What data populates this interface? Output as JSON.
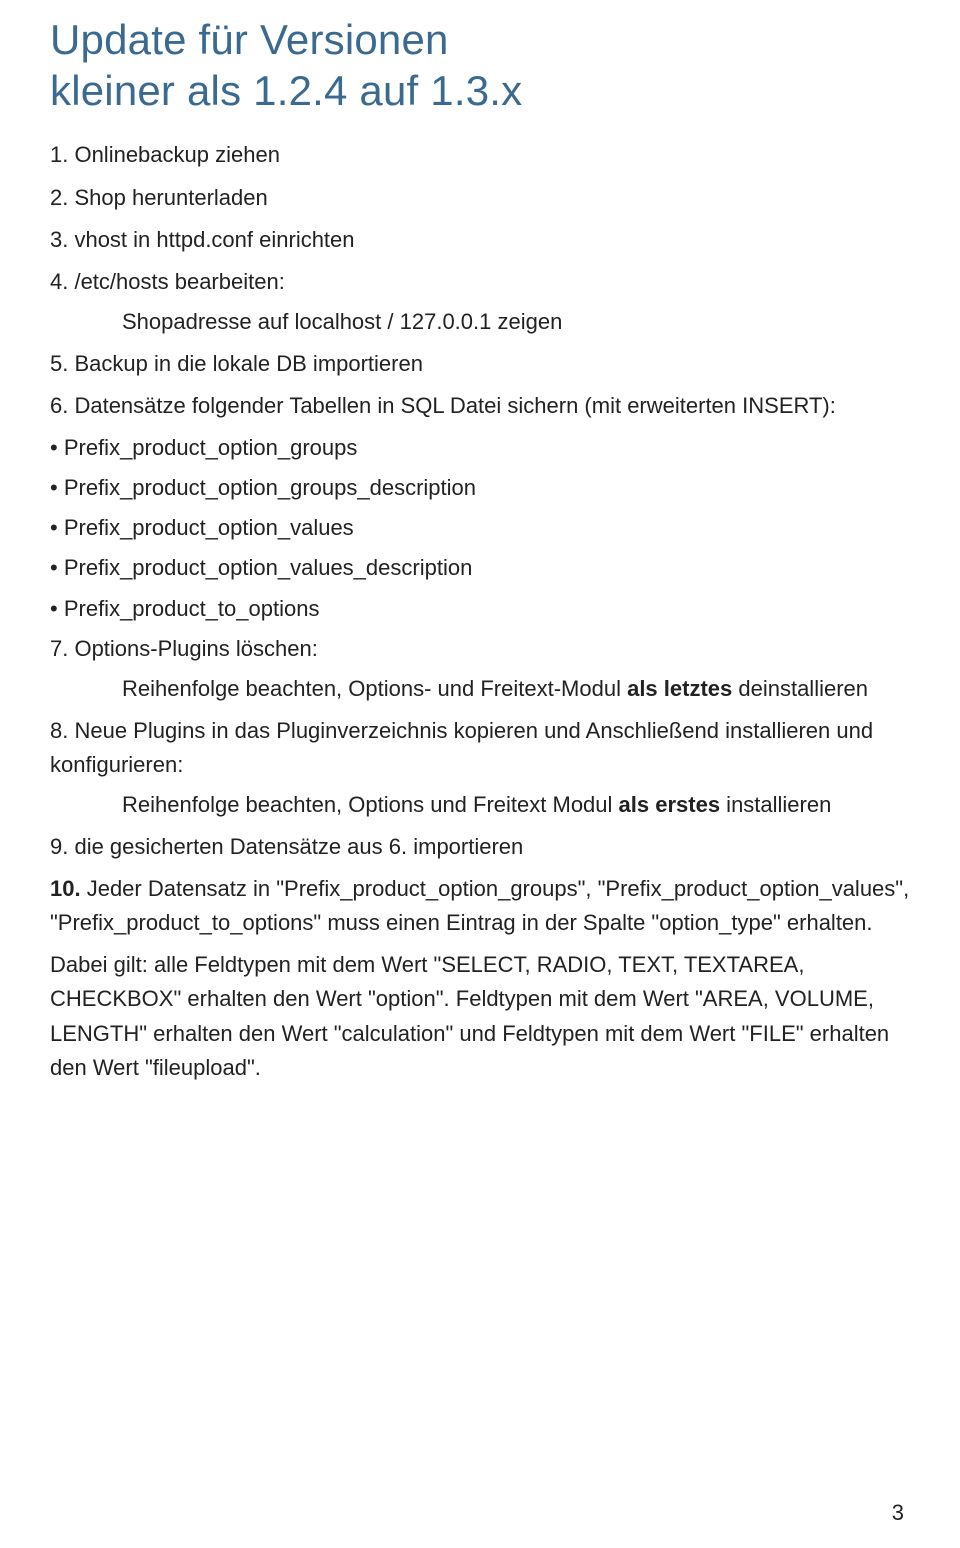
{
  "title_line1": "Update für Versionen",
  "title_line2": "kleiner als 1.2.4 auf 1.3.x",
  "steps": {
    "s1": "1. Onlinebackup ziehen",
    "s2": "2. Shop herunterladen",
    "s3": "3. vhost in httpd.conf einrichten",
    "s4": "4. /etc/hosts bearbeiten:",
    "s4a": "Shopadresse auf localhost / 127.0.0.1 zeigen",
    "s5": "5. Backup in die lokale DB importieren",
    "s6": "6. Datensätze folgender Tabellen in SQL Datei sichern (mit erweiterten INSERT):",
    "bullets6": [
      "Prefix_product_option_groups",
      "Prefix_product_option_groups_description",
      "Prefix_product_option_values",
      "Prefix_product_option_values_description",
      "Prefix_product_to_options"
    ],
    "s7": "7. Options-Plugins löschen:",
    "s7a_pre": "Reihenfolge beachten, Options- und Freitext-Modul ",
    "s7a_bold": "als letztes",
    "s7a_post": " deinstallieren",
    "s8": "8. Neue Plugins in das Pluginverzeichnis kopieren und Anschließend installieren und konfigurieren:",
    "s8a_pre": "Reihenfolge beachten, Options und Freitext Modul ",
    "s8a_bold": "als erstes",
    "s8a_post": " installieren",
    "s9": "9. die gesicherten Datensätze aus 6. importieren",
    "s10_pre": "10.",
    "s10_txt": " Jeder Datensatz in \"Prefix_product_option_groups\", \"Prefix_product_option_values\", \"Prefix_product_to_options\" muss einen Eintrag in der Spalte \"option_type\" erhalten.",
    "p_after": "Dabei gilt: alle Feldtypen mit dem Wert \"SELECT, RADIO, TEXT, TEXTAREA, CHECKBOX\" erhalten den Wert \"option\". Feldtypen mit dem Wert \"AREA, VOLUME, LENGTH\" erhalten den Wert \"calculation\" und Feldtypen mit dem Wert \"FILE\" erhalten den Wert \"fileupload\"."
  },
  "page_number": "3"
}
